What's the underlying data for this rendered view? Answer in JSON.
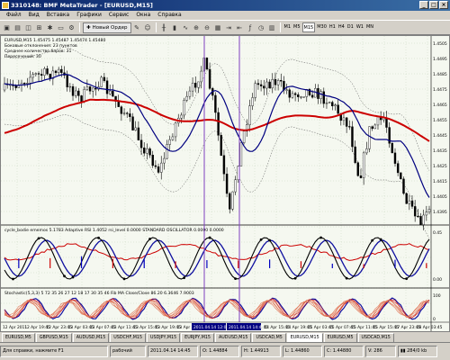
{
  "window": {
    "title": "3310148: BMF MetaTrader - [EURUSD,M15]",
    "buttons": [
      "_",
      "□",
      "×"
    ]
  },
  "menu": [
    "Файл",
    "Вид",
    "Вставка",
    "Графики",
    "Сервис",
    "Окна",
    "Справка"
  ],
  "toolbar": {
    "new_order_label": "Новый Ордер",
    "timeframes": [
      "M1",
      "M5",
      "M15",
      "M30",
      "H1",
      "H4",
      "D1",
      "W1",
      "MN"
    ],
    "active_timeframe": "M15"
  },
  "chart": {
    "symbol_header": "EURUSD,M15  1.45475 1.45487 1.45474 1.45480",
    "info_lines": [
      "Боковые отклонения: 23 пунктов",
      "Среднее количество баров: 31",
      "Пересечений: 30"
    ],
    "price_ticks": [
      "1.4505",
      "1.4495",
      "1.4485",
      "1.4475",
      "1.4465",
      "1.4455",
      "1.4445",
      "1.4435",
      "1.4425",
      "1.4415",
      "1.4405",
      "1.4395"
    ],
    "indicator1_label": "cycle_bodie ememos 5.1783   Adaptive RSI 1.4052   rsi_level  0.0000 STANDARD OSCILLATOR 0.0000 0.0000",
    "indicator1_ticks": [
      "0.45",
      "0.00"
    ],
    "indicator2_label": "Stochastic(5,3,3) 5 72 35 26 27 12 18 17 30 35 46 Fib MA Close/Close 86.20 6.3646 7.9003",
    "indicator2_ticks": [
      "100",
      "0"
    ],
    "date_labels": [
      "12 Apr 2011",
      "12 Apr 19:45",
      "12 Apr 23:45",
      "13 Apr 03:45",
      "13 Apr 07:45",
      "13 Apr 11:45",
      "13 Apr 15:45",
      "13 Apr 19:45",
      "13 Apr 23:45",
      "14 Apr 03:45",
      "14 Apr 07:45",
      "14 Apr 11:45",
      "14 Apr 15:45",
      "14 Apr 19:45",
      "15 Apr 03:45",
      "15 Apr 07:45",
      "15 Apr 11:45",
      "15 Apr 15:45",
      "17 Apr 23:45",
      "18 Apr 03:45"
    ],
    "cursor_times": [
      "2011.04.14 12:00",
      "2011.04.14 14:45"
    ]
  },
  "symbol_tabs": [
    "EURUSD,M5",
    "GBPUSD,M15",
    "AUDUSD,M15",
    "USDCHF,M15",
    "USDJPY,M15",
    "EURJPY,M15",
    "AUDUSD,M15",
    "USDCAD,M5",
    "EURUSD,M15",
    "EURUSD,M5",
    "USDCAD,M15"
  ],
  "active_tab": "EURUSD,M15",
  "status": {
    "help": "Для справки, нажмите F1",
    "profile": "рабочий",
    "datetime": "2011.04.14 14:45",
    "open": "O: 1.44884",
    "high": "H: 1.44913",
    "low": "L: 1.44860",
    "close": "C: 1.44880",
    "volume": "V: 286",
    "traffic": "284/0 kb"
  },
  "colors": {
    "ma_slow": "#cc0000",
    "ma_fast": "#000080",
    "cursor_line": "#8040c0",
    "grid": "#c8d8c0"
  }
}
